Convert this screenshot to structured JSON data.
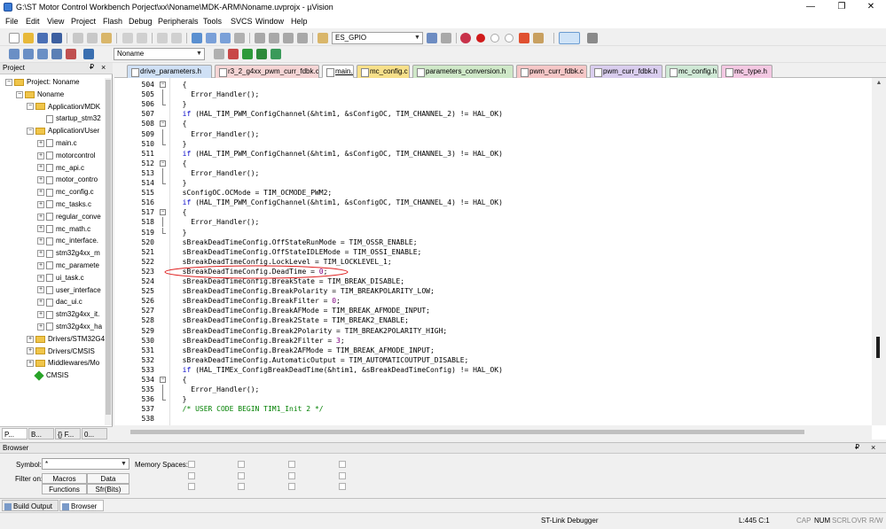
{
  "window": {
    "title": "G:\\ST Motor Control Workbench Porject\\xx\\Noname\\MDK-ARM\\Noname.uvprojx - µVision",
    "minimize": "—",
    "maximize": "❐",
    "close": "✕"
  },
  "menu": [
    "File",
    "Edit",
    "View",
    "Project",
    "Flash",
    "Debug",
    "Peripherals",
    "Tools",
    "SVCS",
    "Window",
    "Help"
  ],
  "toolbar": {
    "find_combo": "ES_GPIO",
    "target_combo": "Noname"
  },
  "project": {
    "title": "Project",
    "pin": "₽",
    "close": "×",
    "tree": [
      {
        "label": "Project: Noname",
        "depth": 0,
        "type": "root",
        "toggle": "−"
      },
      {
        "label": "Noname",
        "depth": 1,
        "type": "target",
        "toggle": "−"
      },
      {
        "label": "Application/MDK",
        "depth": 2,
        "type": "folder",
        "toggle": "−"
      },
      {
        "label": "startup_stm32",
        "depth": 3,
        "type": "file",
        "toggle": ""
      },
      {
        "label": "Application/User",
        "depth": 2,
        "type": "folder",
        "toggle": "−"
      },
      {
        "label": "main.c",
        "depth": 3,
        "type": "file",
        "toggle": "+"
      },
      {
        "label": "motorcontrol",
        "depth": 3,
        "type": "file",
        "toggle": "+"
      },
      {
        "label": "mc_api.c",
        "depth": 3,
        "type": "file",
        "toggle": "+"
      },
      {
        "label": "motor_contro",
        "depth": 3,
        "type": "file",
        "toggle": "+"
      },
      {
        "label": "mc_config.c",
        "depth": 3,
        "type": "file",
        "toggle": "+"
      },
      {
        "label": "mc_tasks.c",
        "depth": 3,
        "type": "file",
        "toggle": "+"
      },
      {
        "label": "regular_conve",
        "depth": 3,
        "type": "file",
        "toggle": "+"
      },
      {
        "label": "mc_math.c",
        "depth": 3,
        "type": "file",
        "toggle": "+"
      },
      {
        "label": "mc_interface.",
        "depth": 3,
        "type": "file",
        "toggle": "+"
      },
      {
        "label": "stm32g4xx_m",
        "depth": 3,
        "type": "file",
        "toggle": "+"
      },
      {
        "label": "mc_paramete",
        "depth": 3,
        "type": "file",
        "toggle": "+"
      },
      {
        "label": "ui_task.c",
        "depth": 3,
        "type": "file",
        "toggle": "+"
      },
      {
        "label": "user_interface",
        "depth": 3,
        "type": "file",
        "toggle": "+"
      },
      {
        "label": "dac_ui.c",
        "depth": 3,
        "type": "file",
        "toggle": "+"
      },
      {
        "label": "stm32g4xx_it.",
        "depth": 3,
        "type": "file",
        "toggle": "+"
      },
      {
        "label": "stm32g4xx_ha",
        "depth": 3,
        "type": "file",
        "toggle": "+"
      },
      {
        "label": "Drivers/STM32G4",
        "depth": 2,
        "type": "folder",
        "toggle": "+"
      },
      {
        "label": "Drivers/CMSIS",
        "depth": 2,
        "type": "folder",
        "toggle": "+"
      },
      {
        "label": "Middlewares/Mo",
        "depth": 2,
        "type": "folder",
        "toggle": "+"
      },
      {
        "label": "CMSIS",
        "depth": 2,
        "type": "component",
        "toggle": ""
      }
    ],
    "bottom_tabs": [
      "P...",
      "B...",
      "{} F...",
      "0... "
    ]
  },
  "editor": {
    "tabs": [
      {
        "label": "drive_parameters.h",
        "color": "#cfe0f5",
        "active": false
      },
      {
        "label": "r3_2_g4xx_pwm_curr_fdbk.c",
        "color": "#f5d5d5",
        "active": false
      },
      {
        "label": "main.c",
        "color": "#ffffff",
        "active": true
      },
      {
        "label": "mc_config.c",
        "color": "#f7e08a",
        "active": false
      },
      {
        "label": "parameters_conversion.h",
        "color": "#cfe8c8",
        "active": false
      },
      {
        "label": "pwm_curr_fdbk.c",
        "color": "#f5c7c7",
        "active": false
      },
      {
        "label": "pwm_curr_fdbk.h",
        "color": "#d9cdee",
        "active": false
      },
      {
        "label": "mc_config.h",
        "color": "#cfe8d5",
        "active": false
      },
      {
        "label": "mc_type.h",
        "color": "#f3c8e2",
        "active": false
      }
    ],
    "lines": [
      {
        "n": "504",
        "text": "  {"
      },
      {
        "n": "505",
        "text": "    Error_Handler();"
      },
      {
        "n": "506",
        "text": "  }"
      },
      {
        "n": "507",
        "text": "  if (HAL_TIM_PWM_ConfigChannel(&htim1, &sConfigOC, TIM_CHANNEL_2) != HAL_OK)"
      },
      {
        "n": "508",
        "text": "  {"
      },
      {
        "n": "509",
        "text": "    Error_Handler();"
      },
      {
        "n": "510",
        "text": "  }"
      },
      {
        "n": "511",
        "text": "  if (HAL_TIM_PWM_ConfigChannel(&htim1, &sConfigOC, TIM_CHANNEL_3) != HAL_OK)"
      },
      {
        "n": "512",
        "text": "  {"
      },
      {
        "n": "513",
        "text": "    Error_Handler();"
      },
      {
        "n": "514",
        "text": "  }"
      },
      {
        "n": "515",
        "text": "  sConfigOC.OCMode = TIM_OCMODE_PWM2;"
      },
      {
        "n": "516",
        "text": "  if (HAL_TIM_PWM_ConfigChannel(&htim1, &sConfigOC, TIM_CHANNEL_4) != HAL_OK)"
      },
      {
        "n": "517",
        "text": "  {"
      },
      {
        "n": "518",
        "text": "    Error_Handler();"
      },
      {
        "n": "519",
        "text": "  }"
      },
      {
        "n": "520",
        "text": "  sBreakDeadTimeConfig.OffStateRunMode = TIM_OSSR_ENABLE;"
      },
      {
        "n": "521",
        "text": "  sBreakDeadTimeConfig.OffStateIDLEMode = TIM_OSSI_ENABLE;"
      },
      {
        "n": "522",
        "text": "  sBreakDeadTimeConfig.LockLevel = TIM_LOCKLEVEL_1;"
      },
      {
        "n": "523",
        "text": "  sBreakDeadTimeConfig.DeadTime = 0;"
      },
      {
        "n": "524",
        "text": "  sBreakDeadTimeConfig.BreakState = TIM_BREAK_DISABLE;"
      },
      {
        "n": "525",
        "text": "  sBreakDeadTimeConfig.BreakPolarity = TIM_BREAKPOLARITY_LOW;"
      },
      {
        "n": "526",
        "text": "  sBreakDeadTimeConfig.BreakFilter = 0;"
      },
      {
        "n": "527",
        "text": "  sBreakDeadTimeConfig.BreakAFMode = TIM_BREAK_AFMODE_INPUT;"
      },
      {
        "n": "528",
        "text": "  sBreakDeadTimeConfig.Break2State = TIM_BREAK2_ENABLE;"
      },
      {
        "n": "529",
        "text": "  sBreakDeadTimeConfig.Break2Polarity = TIM_BREAK2POLARITY_HIGH;"
      },
      {
        "n": "530",
        "text": "  sBreakDeadTimeConfig.Break2Filter = 3;"
      },
      {
        "n": "531",
        "text": "  sBreakDeadTimeConfig.Break2AFMode = TIM_BREAK_AFMODE_INPUT;"
      },
      {
        "n": "532",
        "text": "  sBreakDeadTimeConfig.AutomaticOutput = TIM_AUTOMATICOUTPUT_DISABLE;"
      },
      {
        "n": "533",
        "text": "  if (HAL_TIMEx_ConfigBreakDeadTime(&htim1, &sBreakDeadTimeConfig) != HAL_OK)"
      },
      {
        "n": "534",
        "text": "  {"
      },
      {
        "n": "535",
        "text": "    Error_Handler();"
      },
      {
        "n": "536",
        "text": "  }"
      },
      {
        "n": "537",
        "text": "  /* USER CODE BEGIN TIM1_Init 2 */"
      },
      {
        "n": "538",
        "text": ""
      }
    ]
  },
  "browser": {
    "title": "Browser",
    "symbol_label": "Symbol:",
    "symbol_value": "*",
    "filter_label": "Filter on:",
    "memory_label": "Memory Spaces:",
    "btn_macros": "Macros",
    "btn_data": "Data",
    "btn_functions": "Functions",
    "btn_sfr": "Sfr(Bits)"
  },
  "bottom_tabs": {
    "build": "Build Output",
    "browser": "Browser"
  },
  "status": {
    "debugger": "ST-Link Debugger",
    "position": "L:445 C:1",
    "cap": "CAP",
    "num": "NUM",
    "scrl": "SCRL",
    "ovr": "OVR",
    "rw": "R/W"
  }
}
